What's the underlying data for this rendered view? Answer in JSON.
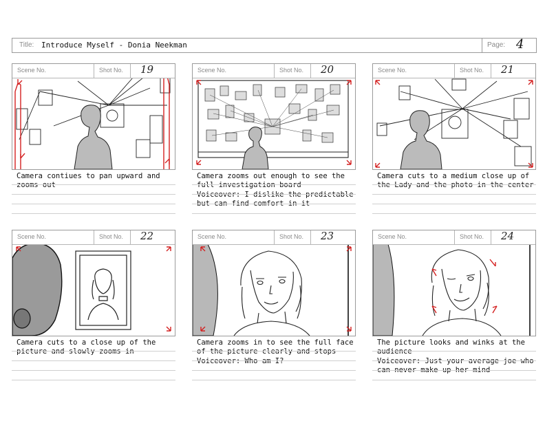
{
  "header": {
    "title_label": "Title:",
    "title_value": "Introduce Myself - Donia Neekman",
    "page_label": "Page:",
    "page_value": "4"
  },
  "panels": [
    {
      "scene_label": "Scene No.",
      "shot_label": "Shot No.",
      "shot_number": "19",
      "caption": "Camera contiues to pan upward and\nzooms out"
    },
    {
      "scene_label": "Scene No.",
      "shot_label": "Shot No.",
      "shot_number": "20",
      "caption": "Camera zooms out enough to see the\nfull investigation board\nVoiceover: I dislike the predictable\nbut can find comfort in it"
    },
    {
      "scene_label": "Scene No.",
      "shot_label": "Shot No.",
      "shot_number": "21",
      "caption": "Camera cuts to a medium close up of\nthe Lady and the photo in the center"
    },
    {
      "scene_label": "Scene No.",
      "shot_label": "Shot No.",
      "shot_number": "22",
      "caption": "Camera cuts to a close up of the\npicture and slowly zooms in"
    },
    {
      "scene_label": "Scene No.",
      "shot_label": "Shot No.",
      "shot_number": "23",
      "caption": "Camera zooms in to see the full face\nof the picture clearly and stops\nVoiceover: Who am I?"
    },
    {
      "scene_label": "Scene No.",
      "shot_label": "Shot No.",
      "shot_number": "24",
      "caption": "The picture looks and winks at the\naudience\nVoiceover: Just your average joe who\ncan never make up her mind"
    }
  ],
  "colors": {
    "arrow": "#d42020",
    "line": "#222222",
    "border": "#9a9a9a"
  }
}
